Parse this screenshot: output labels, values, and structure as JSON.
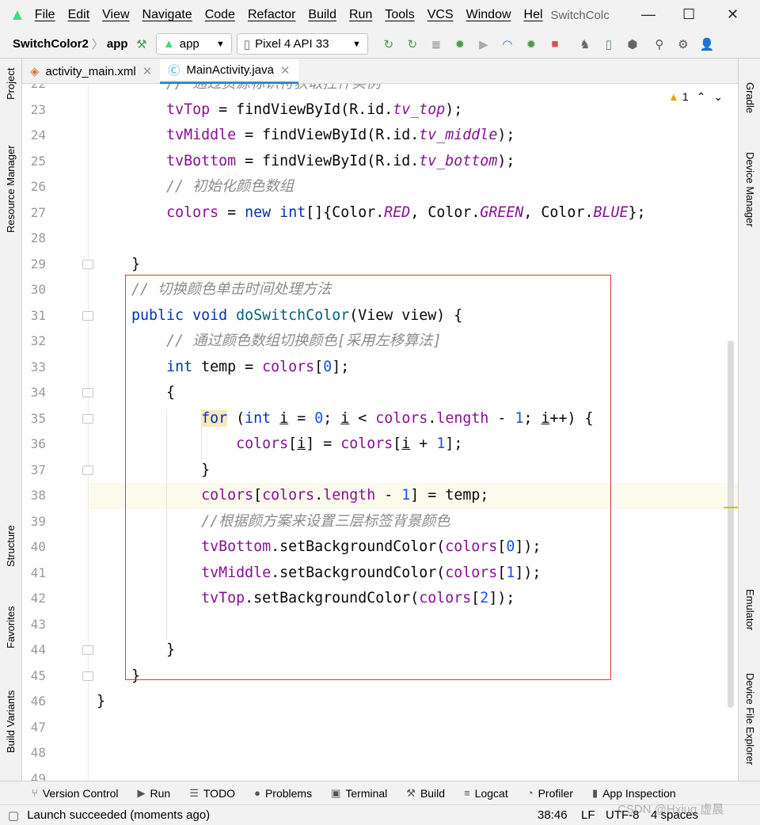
{
  "menu": [
    "File",
    "Edit",
    "View",
    "Navigate",
    "Code",
    "Refactor",
    "Build",
    "Run",
    "Tools",
    "VCS",
    "Window",
    "Hel"
  ],
  "window_title": "SwitchColc",
  "toolbar": {
    "project": "SwitchColor2",
    "module": "app",
    "run_config": "app",
    "device": "Pixel 4 API 33"
  },
  "tabs": [
    {
      "label": "activity_main.xml",
      "active": false
    },
    {
      "label": "MainActivity.java",
      "active": true
    }
  ],
  "left_tools": [
    "Project",
    "Resource Manager",
    "Structure",
    "Favorites",
    "Build Variants"
  ],
  "right_tools": [
    "Gradle",
    "Device Manager",
    "Emulator",
    "Device File Explorer"
  ],
  "inspection": {
    "warnings": "1"
  },
  "colors": {
    "accent": "#4083c9",
    "keyword": "#0033b3",
    "field": "#871094",
    "comment": "#8c8c8c",
    "number": "#1750eb",
    "highlight_box": "#e53935"
  },
  "code": {
    "first_line": 22,
    "current_line": 38,
    "lines": [
      [
        [
          "        // 通过资源标识符获取控件实例",
          "c"
        ]
      ],
      [
        [
          "        ",
          ""
        ],
        [
          "tvTop",
          "f"
        ],
        [
          " = findViewById(R.id.",
          ""
        ],
        [
          "tv_top",
          "s"
        ],
        [
          ");",
          ""
        ]
      ],
      [
        [
          "        ",
          ""
        ],
        [
          "tvMiddle",
          "f"
        ],
        [
          " = findViewById(R.id.",
          ""
        ],
        [
          "tv_middle",
          "s"
        ],
        [
          ");",
          ""
        ]
      ],
      [
        [
          "        ",
          ""
        ],
        [
          "tvBottom",
          "f"
        ],
        [
          " = findViewById(R.id.",
          ""
        ],
        [
          "tv_bottom",
          "s"
        ],
        [
          ");",
          ""
        ]
      ],
      [
        [
          "        // 初始化颜色数组",
          "c"
        ]
      ],
      [
        [
          "        ",
          ""
        ],
        [
          "colors",
          "f"
        ],
        [
          " = ",
          ""
        ],
        [
          "new",
          "k"
        ],
        [
          " ",
          ""
        ],
        [
          "int",
          "k"
        ],
        [
          "[]{Color.",
          ""
        ],
        [
          "RED",
          "s"
        ],
        [
          ", Color.",
          ""
        ],
        [
          "GREEN",
          "s"
        ],
        [
          ", Color.",
          ""
        ],
        [
          "BLUE",
          "s"
        ],
        [
          "};",
          ""
        ]
      ],
      [],
      [
        [
          "    }",
          ""
        ]
      ],
      [
        [
          "    // 切换颜色单击时间处理方法",
          "c"
        ]
      ],
      [
        [
          "    ",
          ""
        ],
        [
          "public",
          "k"
        ],
        [
          " ",
          ""
        ],
        [
          "void",
          "k"
        ],
        [
          " ",
          ""
        ],
        [
          "doSwitchColor",
          "m"
        ],
        [
          "(View view) {",
          ""
        ]
      ],
      [
        [
          "        // 通过颜色数组切换颜色[采用左移算法]",
          "c"
        ]
      ],
      [
        [
          "        ",
          ""
        ],
        [
          "int",
          "k"
        ],
        [
          " temp = ",
          ""
        ],
        [
          "colors",
          "f"
        ],
        [
          "[",
          ""
        ],
        [
          "0",
          "n"
        ],
        [
          "];",
          ""
        ]
      ],
      [
        [
          "        {",
          ""
        ]
      ],
      [
        [
          "            ",
          ""
        ],
        [
          "for",
          "h"
        ],
        [
          " (",
          ""
        ],
        [
          "int",
          "k"
        ],
        [
          " ",
          ""
        ],
        [
          "i",
          "u"
        ],
        [
          " = ",
          ""
        ],
        [
          "0",
          "n"
        ],
        [
          "; ",
          ""
        ],
        [
          "i",
          "u"
        ],
        [
          " < ",
          ""
        ],
        [
          "colors",
          "f"
        ],
        [
          ".",
          ""
        ],
        [
          "length",
          "f"
        ],
        [
          " - ",
          ""
        ],
        [
          "1",
          "n"
        ],
        [
          "; ",
          ""
        ],
        [
          "i",
          "u"
        ],
        [
          "++) {",
          ""
        ]
      ],
      [
        [
          "                ",
          ""
        ],
        [
          "colors",
          "f"
        ],
        [
          "[",
          ""
        ],
        [
          "i",
          "u"
        ],
        [
          "] = ",
          ""
        ],
        [
          "colors",
          "f"
        ],
        [
          "[",
          ""
        ],
        [
          "i",
          "u"
        ],
        [
          " + ",
          ""
        ],
        [
          "1",
          "n"
        ],
        [
          "];",
          ""
        ]
      ],
      [
        [
          "            }",
          ""
        ]
      ],
      [
        [
          "            ",
          ""
        ],
        [
          "colors",
          "f"
        ],
        [
          "[",
          ""
        ],
        [
          "colors",
          "f"
        ],
        [
          ".",
          ""
        ],
        [
          "length",
          "f"
        ],
        [
          " - ",
          ""
        ],
        [
          "1",
          "n"
        ],
        [
          "] = temp;",
          ""
        ]
      ],
      [
        [
          "            //根据颜方案来设置三层标签背景颜色",
          "c"
        ]
      ],
      [
        [
          "            ",
          ""
        ],
        [
          "tvBottom",
          "f"
        ],
        [
          ".setBackgroundColor(",
          ""
        ],
        [
          "colors",
          "f"
        ],
        [
          "[",
          ""
        ],
        [
          "0",
          "n"
        ],
        [
          "]);",
          ""
        ]
      ],
      [
        [
          "            ",
          ""
        ],
        [
          "tvMiddle",
          "f"
        ],
        [
          ".setBackgroundColor(",
          ""
        ],
        [
          "colors",
          "f"
        ],
        [
          "[",
          ""
        ],
        [
          "1",
          "n"
        ],
        [
          "]);",
          ""
        ]
      ],
      [
        [
          "            ",
          ""
        ],
        [
          "tvTop",
          "f"
        ],
        [
          ".setBackgroundColor(",
          ""
        ],
        [
          "colors",
          "f"
        ],
        [
          "[",
          ""
        ],
        [
          "2",
          "n"
        ],
        [
          "]);",
          ""
        ]
      ],
      [],
      [
        [
          "        }",
          ""
        ]
      ],
      [
        [
          "    }",
          ""
        ]
      ],
      [
        [
          "}",
          ""
        ]
      ],
      [],
      [],
      []
    ]
  },
  "bottom_tools": [
    {
      "icon": "version-control-icon",
      "glyph": "⑂",
      "label": "Version Control"
    },
    {
      "icon": "run-icon",
      "glyph": "▶",
      "label": "Run"
    },
    {
      "icon": "todo-icon",
      "glyph": "☰",
      "label": "TODO"
    },
    {
      "icon": "problems-icon",
      "glyph": "●",
      "label": "Problems"
    },
    {
      "icon": "terminal-icon",
      "glyph": "▣",
      "label": "Terminal"
    },
    {
      "icon": "build-icon",
      "glyph": "⚒",
      "label": "Build"
    },
    {
      "icon": "logcat-icon",
      "glyph": "≡",
      "label": "Logcat"
    },
    {
      "icon": "profiler-icon",
      "glyph": "◔",
      "label": "Profiler"
    },
    {
      "icon": "app-inspection-icon",
      "glyph": "▮",
      "label": "App Inspection"
    }
  ],
  "status": {
    "message": "Launch succeeded (moments ago)",
    "position": "38:46",
    "line_sep": "LF",
    "encoding": "UTF-8",
    "indent": "4 spaces",
    "watermark": "CSDN @Hxiuq 虚晨"
  }
}
